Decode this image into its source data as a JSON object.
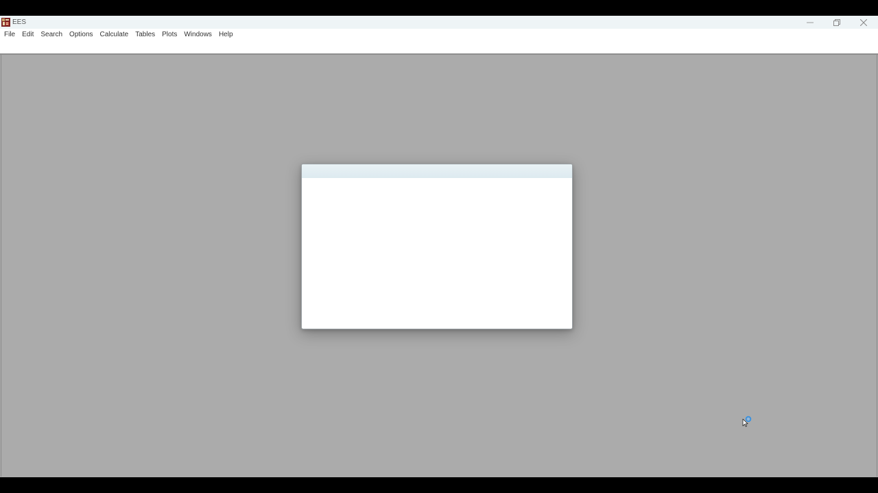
{
  "window": {
    "title": "EES",
    "icon": "ees-app-icon",
    "controls": {
      "minimize": "minimize-icon",
      "maximize": "restore-icon",
      "close": "close-icon"
    }
  },
  "menu": {
    "items": [
      {
        "label": "File"
      },
      {
        "label": "Edit"
      },
      {
        "label": "Search"
      },
      {
        "label": "Options"
      },
      {
        "label": "Calculate"
      },
      {
        "label": "Tables"
      },
      {
        "label": "Plots"
      },
      {
        "label": "Windows"
      },
      {
        "label": "Help"
      }
    ]
  },
  "splash": {
    "state": "loading"
  },
  "cursor": {
    "type": "busy-pointer-icon"
  },
  "colors": {
    "workspace": "#ababab",
    "title_bar": "#eef4f6",
    "menu_bar": "#ffffff",
    "splash_header": "#e3eef2",
    "busy_indicator": "#2b8fe8"
  }
}
